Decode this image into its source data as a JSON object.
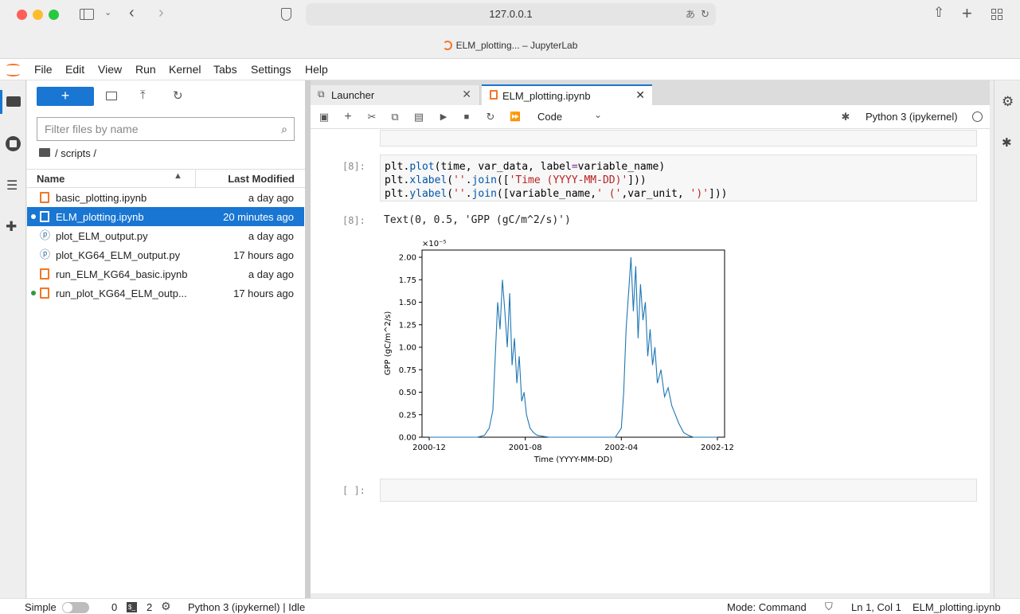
{
  "browser": {
    "url": "127.0.0.1",
    "window_title": "ELM_plotting... – JupyterLab"
  },
  "menu": [
    "File",
    "Edit",
    "View",
    "Run",
    "Kernel",
    "Tabs",
    "Settings",
    "Help"
  ],
  "filebrowser": {
    "new_label": "+",
    "filter_placeholder": "Filter files by name",
    "breadcrumb": "/ scripts /",
    "col_name": "Name",
    "col_modified": "Last Modified",
    "files": [
      {
        "name": "basic_plotting.ipynb",
        "modified": "a day ago",
        "type": "notebook"
      },
      {
        "name": "ELM_plotting.ipynb",
        "modified": "20 minutes ago",
        "type": "notebook"
      },
      {
        "name": "plot_ELM_output.py",
        "modified": "a day ago",
        "type": "python"
      },
      {
        "name": "plot_KG64_ELM_output.py",
        "modified": "17 hours ago",
        "type": "python"
      },
      {
        "name": "run_ELM_KG64_basic.ipynb",
        "modified": "a day ago",
        "type": "notebook"
      },
      {
        "name": "run_plot_KG64_ELM_outp...",
        "modified": "17 hours ago",
        "type": "notebook"
      }
    ]
  },
  "tabs": [
    {
      "label": "Launcher"
    },
    {
      "label": "ELM_plotting.ipynb"
    }
  ],
  "toolbar": {
    "cell_type": "Code",
    "kernel": "Python 3 (ipykernel)"
  },
  "cells": {
    "in_prompt": "[8]:",
    "out_prompt": "[8]:",
    "out_text": "Text(0, 0.5, 'GPP (gC/m^2/s)')",
    "empty_prompt": "[ ]:"
  },
  "chart_data": {
    "type": "line",
    "title": "",
    "xlabel": "Time (YYYY-MM-DD)",
    "ylabel": "GPP (gC/m^2/s)",
    "scale_label": "×10⁻⁵",
    "yticks": [
      "0.00",
      "0.25",
      "0.50",
      "0.75",
      "1.00",
      "1.25",
      "1.50",
      "1.75",
      "2.00"
    ],
    "xticks": [
      "2000-12",
      "2001-08",
      "2002-04",
      "2002-12"
    ],
    "ylim": [
      0,
      2.08
    ],
    "x_months": [
      0,
      3,
      4,
      4.6,
      5,
      5.3,
      5.5,
      5.7,
      5.9,
      6.1,
      6.3,
      6.5,
      6.7,
      6.9,
      7.1,
      7.3,
      7.5,
      7.7,
      7.9,
      8.1,
      8.4,
      8.7,
      9,
      9.5,
      10,
      13,
      15.5,
      16,
      16.2,
      16.4,
      16.6,
      16.8,
      17,
      17.2,
      17.4,
      17.6,
      17.8,
      18,
      18.2,
      18.4,
      18.6,
      18.8,
      19,
      19.3,
      19.6,
      19.9,
      20.2,
      20.5,
      20.8,
      21.2,
      21.6,
      22,
      23,
      24
    ],
    "y_values": [
      0,
      0,
      0,
      0.02,
      0.1,
      0.3,
      0.9,
      1.5,
      1.2,
      1.75,
      1.4,
      1.0,
      1.6,
      0.8,
      1.1,
      0.6,
      0.9,
      0.4,
      0.5,
      0.25,
      0.1,
      0.05,
      0.02,
      0.01,
      0,
      0,
      0,
      0.1,
      0.5,
      1.2,
      1.6,
      2.0,
      1.4,
      1.9,
      1.1,
      1.7,
      1.3,
      1.5,
      0.9,
      1.2,
      0.8,
      1.0,
      0.6,
      0.75,
      0.45,
      0.55,
      0.35,
      0.25,
      0.15,
      0.05,
      0.02,
      0,
      0,
      0
    ]
  },
  "statusbar": {
    "mode_simple": "Simple",
    "terminals": "0",
    "kernels": "2",
    "kernel_status": "Python 3 (ipykernel) | Idle",
    "mode": "Mode: Command",
    "position": "Ln 1, Col 1",
    "filename": "ELM_plotting.ipynb"
  }
}
